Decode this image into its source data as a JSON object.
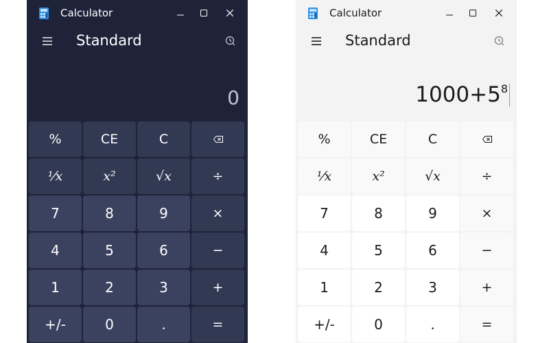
{
  "dark": {
    "title": "Calculator",
    "mode": "Standard",
    "display": {
      "value": "0",
      "exponent": ""
    },
    "keys": [
      "%",
      "CE",
      "C",
      "⌫",
      "⅟x",
      "x²",
      "√x",
      "÷",
      "7",
      "8",
      "9",
      "×",
      "4",
      "5",
      "6",
      "−",
      "1",
      "2",
      "3",
      "+",
      "+/-",
      "0",
      ".",
      "="
    ]
  },
  "light": {
    "title": "Calculator",
    "mode": "Standard",
    "display": {
      "value": "1000+5",
      "exponent": "8"
    },
    "keys": [
      "%",
      "CE",
      "C",
      "⌫",
      "⅟x",
      "x²",
      "√x",
      "÷",
      "7",
      "8",
      "9",
      "×",
      "4",
      "5",
      "6",
      "−",
      "1",
      "2",
      "3",
      "+",
      "+/-",
      "0",
      ".",
      "="
    ]
  }
}
